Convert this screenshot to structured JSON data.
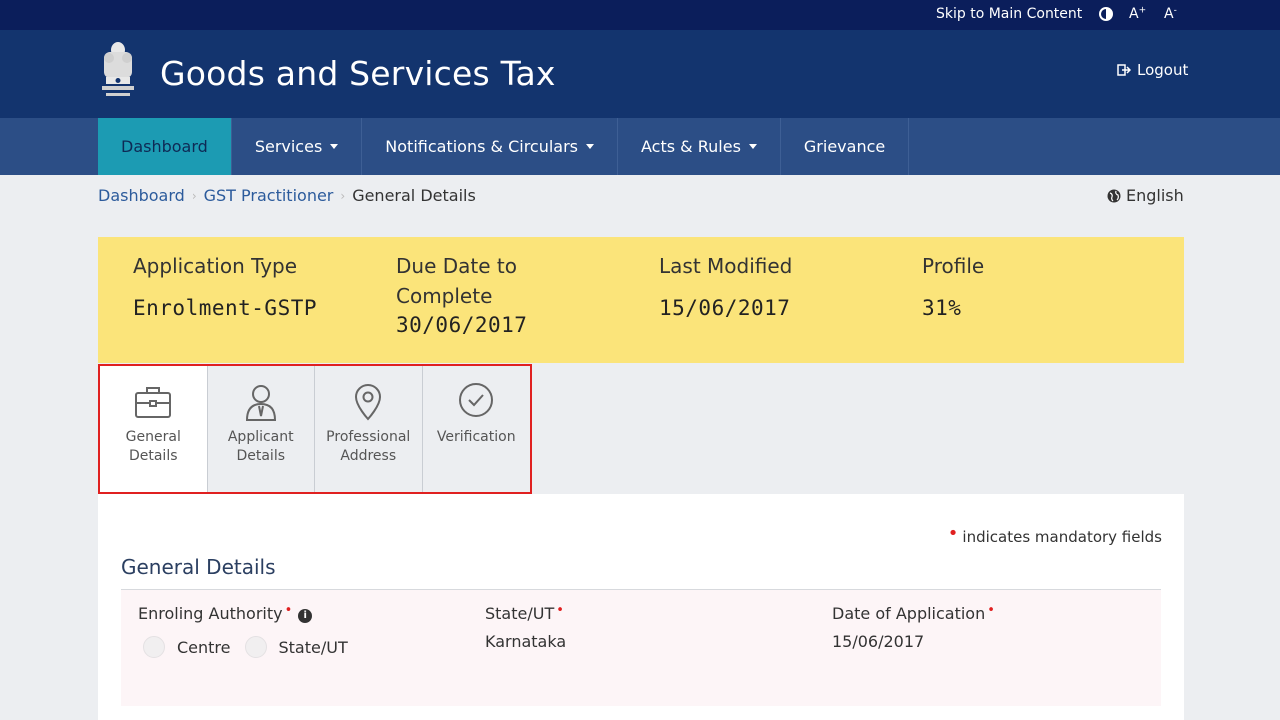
{
  "topbar": {
    "skip_label": "Skip to Main Content",
    "font_increase": "A",
    "font_increase_sup": "+",
    "font_decrease": "A",
    "font_decrease_sup": "-"
  },
  "header": {
    "title": "Goods and Services Tax",
    "logout_label": "Logout"
  },
  "nav": {
    "items": [
      {
        "label": "Dashboard",
        "active": true,
        "dropdown": false
      },
      {
        "label": "Services",
        "dropdown": true
      },
      {
        "label": "Notifications & Circulars",
        "dropdown": true
      },
      {
        "label": "Acts & Rules",
        "dropdown": true
      },
      {
        "label": "Grievance",
        "dropdown": false
      }
    ]
  },
  "breadcrumb": {
    "items": [
      "Dashboard",
      "GST Practitioner"
    ],
    "current": "General Details"
  },
  "language": "English",
  "summary": {
    "application_type_label": "Application Type",
    "application_type_value": "Enrolment-GSTP",
    "due_date_label_1": "Due Date to",
    "due_date_label_2": "Complete",
    "due_date_value": "30/06/2017",
    "last_modified_label": "Last Modified",
    "last_modified_value": "15/06/2017",
    "profile_label": "Profile",
    "profile_value": "31%"
  },
  "tabs": [
    {
      "line1": "General",
      "line2": "Details",
      "icon": "briefcase-icon",
      "active": true
    },
    {
      "line1": "Applicant",
      "line2": "Details",
      "icon": "person-icon"
    },
    {
      "line1": "Professional",
      "line2": "Address",
      "icon": "location-pin-icon"
    },
    {
      "line1": "Verification",
      "line2": "",
      "icon": "check-circle-icon"
    }
  ],
  "form": {
    "mandatory_note": "indicates mandatory fields",
    "section_title": "General Details",
    "enroling_authority_label": "Enroling Authority",
    "radio_centre": "Centre",
    "radio_state": "State/UT",
    "state_label": "State/UT",
    "state_value": "Karnataka",
    "date_label": "Date of Application",
    "date_value": "15/06/2017",
    "required_mark": "•"
  },
  "colors": {
    "topbar": "#0b1e5b",
    "header": "#13346e",
    "nav": "#2c4e86",
    "nav_active": "#1c9bb3",
    "summary": "#fbe47a",
    "highlight_border": "#e02020"
  }
}
